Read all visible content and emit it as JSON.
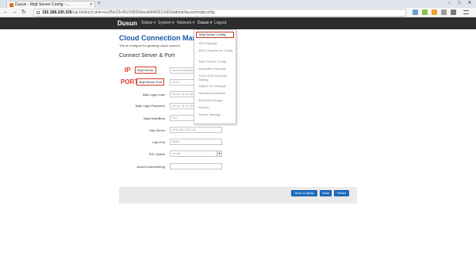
{
  "browser": {
    "tab_title": "Dusun - Mqtt Server Config - ...",
    "url_host": "192.168.100.105",
    "url_path": "/cgi-bin/luci/;stok=ea2f5e23c4523d5650eeab84fd312d52/admin/dusun/mqttconfig"
  },
  "nav": {
    "brand": "Dusun",
    "menus": [
      "Status ▾",
      "System ▾",
      "Network ▾",
      "Dusun ▾",
      "Logout"
    ]
  },
  "dropdown": {
    "selected": "Mqtt Server Config",
    "items": [
      "SSH Manage",
      "AZ/IO Arguments Config",
      "Topic Server Config",
      "Application Manage",
      "TuYa UUID And Key Setting",
      "ZigBee 3.0 Manage",
      "Remote Assistance",
      "Ethernet Manage",
      "Service",
      "ZWave Manage"
    ]
  },
  "page": {
    "title": "Cloud Connection Manage",
    "description": "This is configure for gateway cloud connect",
    "section": "Connect Server & Port"
  },
  "annotations": {
    "ip": "IP",
    "port": "PORT"
  },
  "fields": {
    "mqtt_server": {
      "label": "Mqtt Server",
      "value": "cn0l.ccmlantane"
    },
    "mqtt_port": {
      "label": "Mqtt Server Port",
      "value": "3100"
    },
    "login_user": {
      "label": "Mqtt Login User",
      "value": "35 ac 76 04 06 cc"
    },
    "login_password": {
      "label": "Mqtt Login Password",
      "value": "35 ac 76 04 06 cc"
    },
    "heartbeat": {
      "label": "Mqtt HeartBeat",
      "value": "120"
    },
    "udp_server": {
      "label": "Udp Server",
      "value": "192.168.100.230"
    },
    "udp_port": {
      "label": "Udp Port",
      "value": "6666"
    },
    "ssl_option": {
      "label": "SSL Option",
      "value": "no ssl"
    },
    "azure": {
      "label": "AzureConnectString",
      "value": ""
    }
  },
  "buttons": {
    "save_apply": "Save & Apply",
    "save": "Save",
    "reset": "Reset"
  },
  "colors": {
    "accent": "#1f6fc2",
    "annotation": "#e03a2e",
    "title": "#1a5aa6",
    "navbar": "#2d2d2d"
  }
}
